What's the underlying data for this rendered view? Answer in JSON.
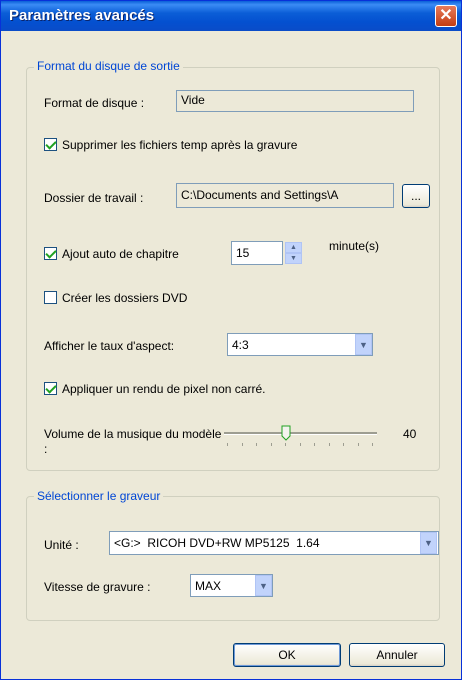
{
  "window": {
    "title": "Paramètres avancés"
  },
  "output_format": {
    "legend": "Format du disque de sortie",
    "disc_format_label": "Format de disque :",
    "disc_format_value": "Vide",
    "delete_temp_label": "Supprimer les fichiers temp après la gravure",
    "delete_temp_checked": true,
    "work_folder_label": "Dossier de travail :",
    "work_folder_value": "C:\\Documents and Settings\\A",
    "browse_label": "...",
    "auto_chapter_label": "Ajout auto de chapitre",
    "auto_chapter_checked": true,
    "auto_chapter_value": "15",
    "minutes_label": "minute(s)",
    "create_dvd_folders_label": "Créer les dossiers DVD",
    "create_dvd_folders_checked": false,
    "aspect_ratio_label": "Afficher le taux d'aspect:",
    "aspect_ratio_value": "4:3",
    "non_square_pixel_label": "Appliquer un rendu de pixel non carré.",
    "non_square_pixel_checked": true,
    "music_volume_label": "Volume de la musique du modèle :",
    "music_volume_value": "40"
  },
  "burner": {
    "legend": "Sélectionner le graveur",
    "unit_label": "Unité :",
    "unit_value": "<G:>  RICOH DVD+RW MP5125  1.64",
    "speed_label": "Vitesse de gravure :",
    "speed_value": "MAX"
  },
  "buttons": {
    "ok": "OK",
    "cancel": "Annuler"
  },
  "icons": {
    "close": "close-icon",
    "dropdown": "chevron-down-icon",
    "spin_up": "arrow-up-icon",
    "spin_down": "arrow-down-icon"
  },
  "colors": {
    "title_bar": "#0a5fd8",
    "legend_text": "#0046d5",
    "dialog_bg": "#ece9d8",
    "close_button": "#c43d12"
  }
}
